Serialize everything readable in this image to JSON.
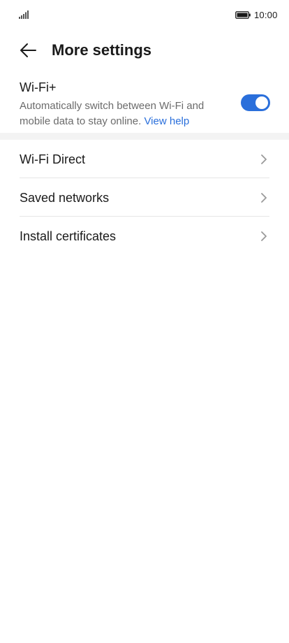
{
  "status_bar": {
    "time": "10:00",
    "signal_icon": "signal-icon",
    "battery_icon": "battery-icon"
  },
  "header": {
    "back_icon": "arrow-left-icon",
    "title": "More settings"
  },
  "wifi_plus": {
    "title": "Wi-Fi+",
    "description": "Automatically switch between Wi-Fi and mobile data to stay online.",
    "help_link": "View help",
    "toggle_on": true
  },
  "list": {
    "items": [
      {
        "label": "Wi-Fi Direct"
      },
      {
        "label": "Saved networks"
      },
      {
        "label": "Install certificates"
      }
    ],
    "chevron_icon": "chevron-right-icon"
  },
  "colors": {
    "accent": "#2a6fdb",
    "text_primary": "#1a1a1a",
    "text_secondary": "#6b6b6b",
    "divider": "#e6e6e6",
    "section_gap": "#f3f3f3"
  }
}
